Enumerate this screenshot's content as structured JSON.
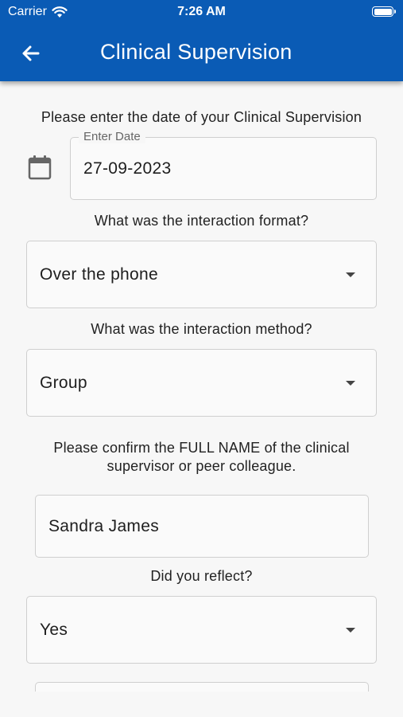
{
  "status_bar": {
    "carrier": "Carrier",
    "time": "7:26 AM"
  },
  "app_bar": {
    "title": "Clinical Supervision",
    "color": "#0a5bb5"
  },
  "form": {
    "date_prompt": "Please enter the date of your Clinical Supervision",
    "date_label": "Enter Date",
    "date_value": "27-09-2023",
    "format_prompt": "What was the interaction format?",
    "format_value": "Over the phone",
    "method_prompt": "What was the interaction method?",
    "method_value": "Group",
    "name_prompt_line1": "Please confirm the FULL NAME of the clinical",
    "name_prompt_line2": "supervisor or peer colleague.",
    "name_value": "Sandra James",
    "reflect_prompt": "Did you reflect?",
    "reflect_value": "Yes"
  },
  "icons": {
    "back": "arrow-left-icon",
    "calendar": "calendar-icon",
    "dropdown": "caret-down-icon",
    "wifi": "wifi-icon",
    "battery": "battery-icon"
  }
}
